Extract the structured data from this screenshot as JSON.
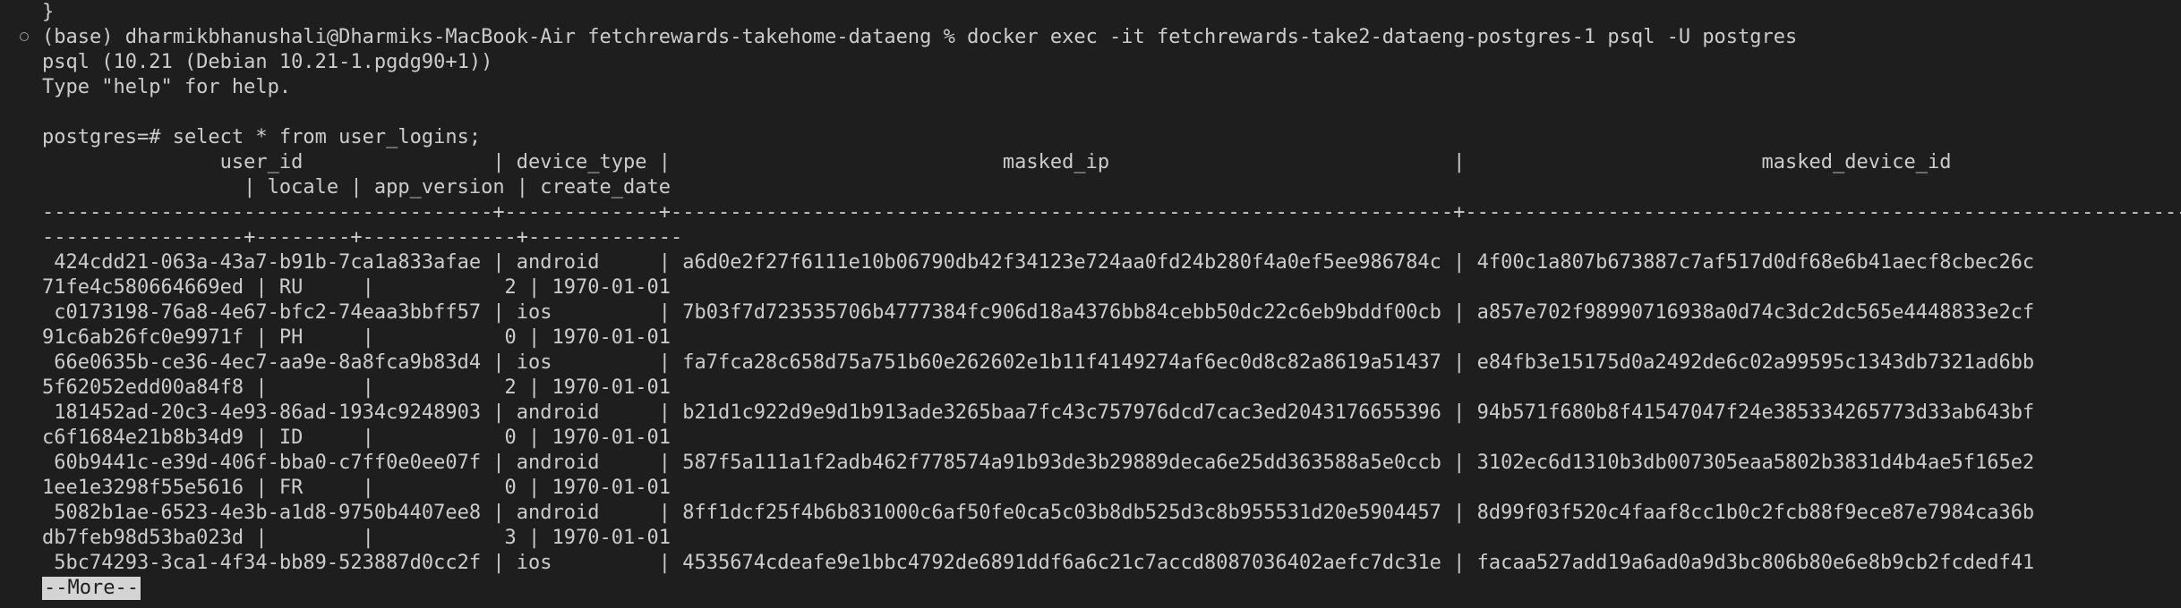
{
  "terminal": {
    "lines": [
      "}",
      "(base) dharmikbhanushali@Dharmiks-MacBook-Air fetchrewards-takehome-dataeng % docker exec -it fetchrewards-take2-dataeng-postgres-1 psql -U postgres",
      "psql (10.21 (Debian 10.21-1.pgdg90+1))",
      "Type \"help\" for help.",
      "",
      "postgres=# select * from user_logins;",
      "               user_id                | device_type |                            masked_ip                             |                         masked_device_id",
      "                 | locale | app_version | create_date",
      "--------------------------------------+-------------+------------------------------------------------------------------+------------------------------------------------------------------",
      "-----------------+--------+-------------+-------------",
      " 424cdd21-063a-43a7-b91b-7ca1a833afae | android     | a6d0e2f27f6111e10b06790db42f34123e724aa0fd24b280f4a0ef5ee986784c | 4f00c1a807b673887c7af517d0df68e6b41aecf8cbec26c",
      "71fe4c580664669ed | RU     |           2 | 1970-01-01",
      " c0173198-76a8-4e67-bfc2-74eaa3bbff57 | ios         | 7b03f7d723535706b4777384fc906d18a4376bb84cebb50dc22c6eb9bddf00cb | a857e702f98990716938a0d74c3dc2dc565e4448833e2cf",
      "91c6ab26fc0e9971f | PH     |           0 | 1970-01-01",
      " 66e0635b-ce36-4ec7-aa9e-8a8fca9b83d4 | ios         | fa7fca28c658d75a751b60e262602e1b11f4149274af6ec0d8c82a8619a51437 | e84fb3e15175d0a2492de6c02a99595c1343db7321ad6bb",
      "5f62052edd00a84f8 |        |           2 | 1970-01-01",
      " 181452ad-20c3-4e93-86ad-1934c9248903 | android     | b21d1c922d9e9d1b913ade3265baa7fc43c757976dcd7cac3ed2043176655396 | 94b571f680b8f41547047f24e385334265773d33ab643bf",
      "c6f1684e21b8b34d9 | ID     |           0 | 1970-01-01",
      " 60b9441c-e39d-406f-bba0-c7ff0e0ee07f | android     | 587f5a111a1f2adb462f778574a91b93de3b29889deca6e25dd363588a5e0ccb | 3102ec6d1310b3db007305eaa5802b3831d4b4ae5f165e2",
      "1ee1e3298f55e5616 | FR     |           0 | 1970-01-01",
      " 5082b1ae-6523-4e3b-a1d8-9750b4407ee8 | android     | 8ff1dcf25f4b6b831000c6af50fe0ca5c03b8db525d3c8b955531d20e5904457 | 8d99f03f520c4faaf8cc1b0c2fcb88f9ece87e7984ca36b",
      "db7feb98d53ba023d |        |           3 | 1970-01-01",
      " 5bc74293-3ca1-4f34-bb89-523887d0cc2f | ios         | 4535674cdeafe9e1bbc4792de6891ddf6a6c21c7accd8087036402aefc7dc31e | facaa527add19a6ad0a9d3bc806b80e6e8b9cb2fcdedf41"
    ],
    "pager_prompt": "--More--"
  }
}
